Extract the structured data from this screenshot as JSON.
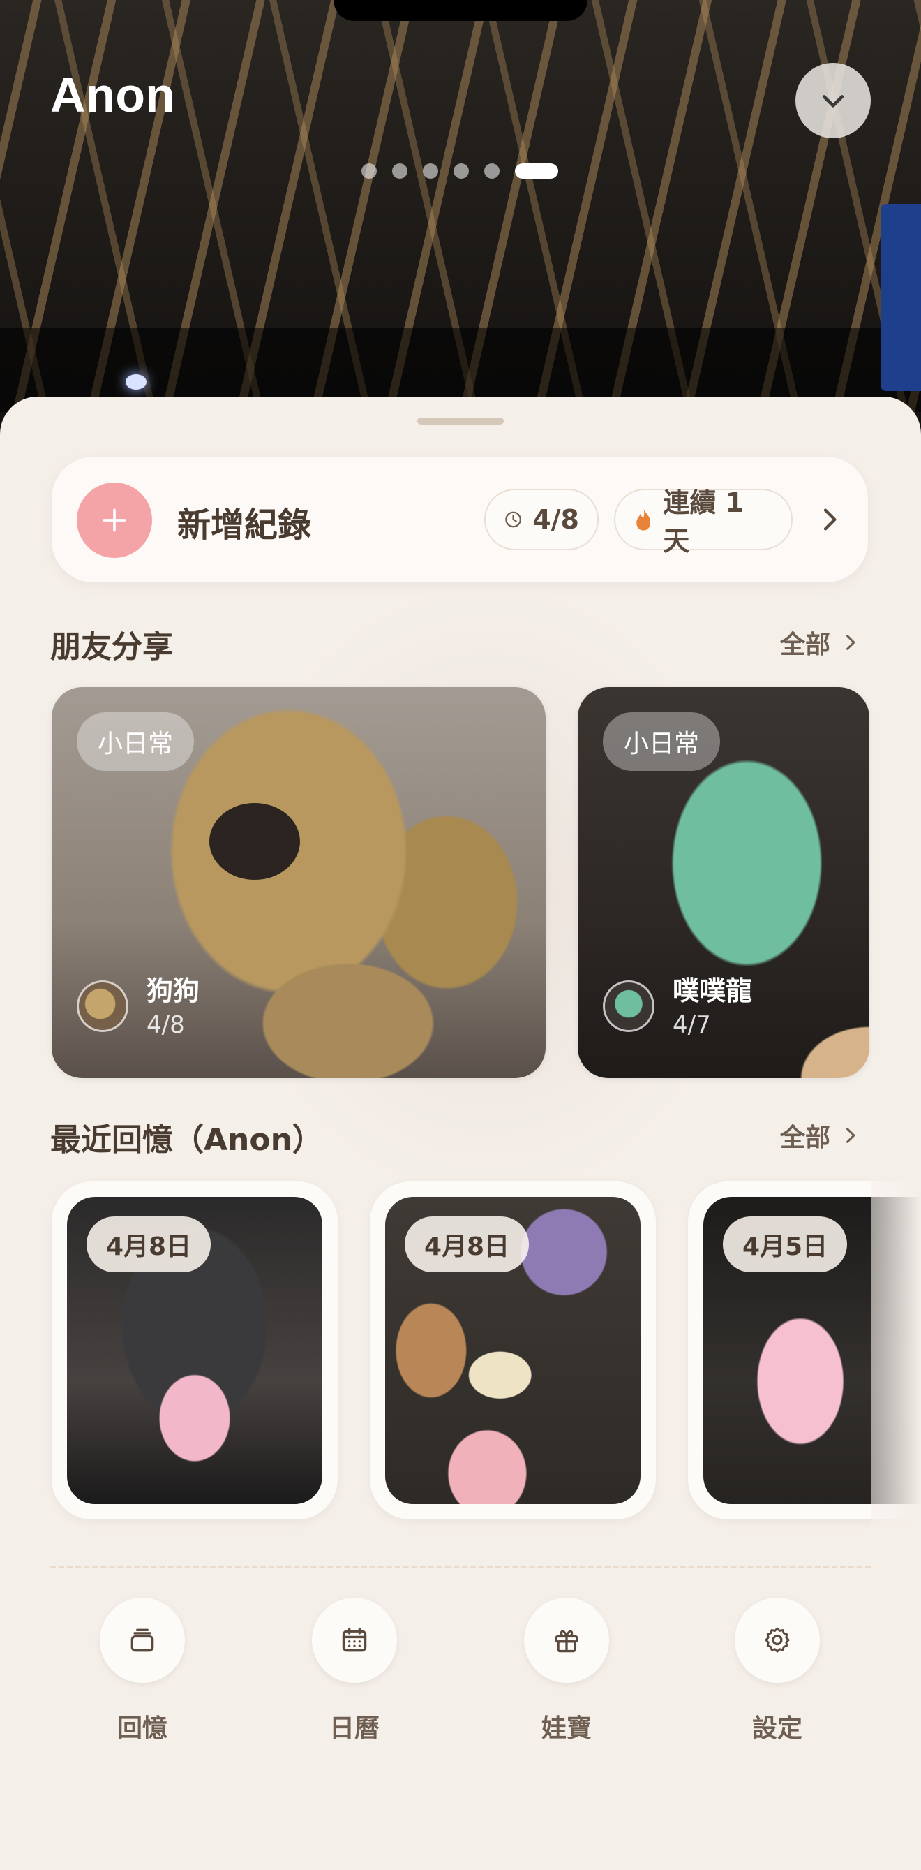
{
  "header": {
    "profile_name": "Anon",
    "page_count": 6,
    "active_page": 6
  },
  "quick_add": {
    "label": "新增紀錄",
    "date": "4/8",
    "streak": "連續 1 天"
  },
  "friends": {
    "title": "朋友分享",
    "see_all": "全部",
    "items": [
      {
        "tag": "小日常",
        "name": "狗狗",
        "date": "4/8"
      },
      {
        "tag": "小日常",
        "name": "噗噗龍",
        "date": "4/7"
      }
    ]
  },
  "memories": {
    "title": "最近回憶（Anon）",
    "see_all": "全部",
    "items": [
      {
        "date": "4月8日"
      },
      {
        "date": "4月8日"
      },
      {
        "date": "4月5日"
      }
    ]
  },
  "nav": {
    "items": [
      {
        "label": "回憶",
        "icon": "memories-icon"
      },
      {
        "label": "日曆",
        "icon": "calendar-icon"
      },
      {
        "label": "娃寶",
        "icon": "gift-icon"
      },
      {
        "label": "設定",
        "icon": "gear-icon"
      }
    ]
  },
  "colors": {
    "accent_pink": "#f4a3a7",
    "streak_flame": "#e8843a",
    "sheet_background": "#f5efea",
    "text_primary": "#4a3b30"
  }
}
